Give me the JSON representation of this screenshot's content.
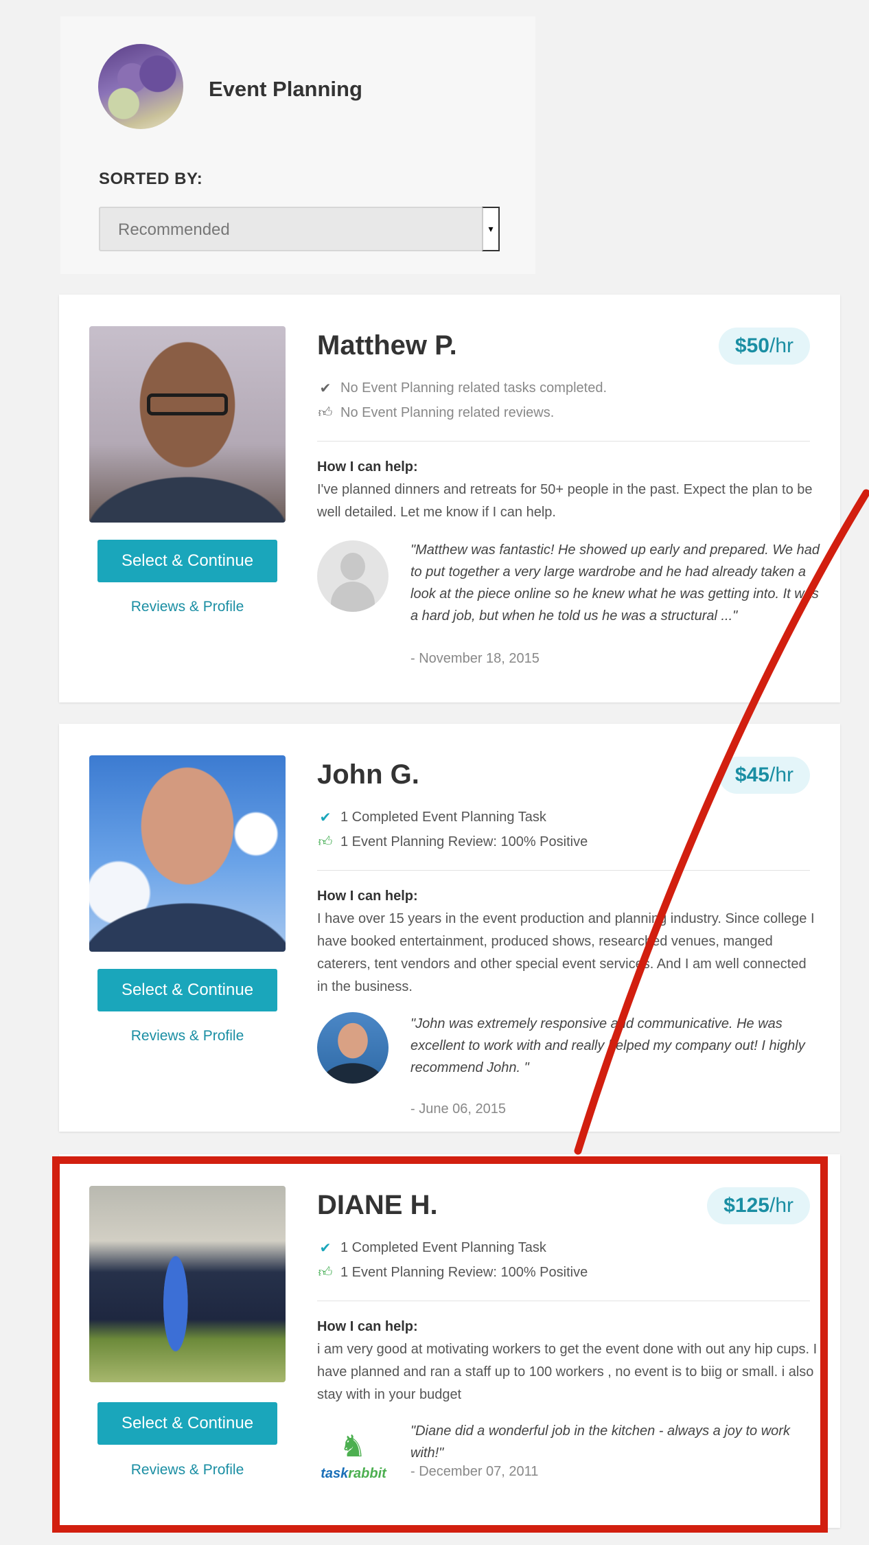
{
  "header": {
    "category_title": "Event Planning",
    "sorted_label": "SORTED BY:",
    "sort_value": "Recommended"
  },
  "taskers": [
    {
      "name": "Matthew P.",
      "price_amount": "$50",
      "price_unit": "/hr",
      "stat_tasks": "No Event Planning related tasks completed.",
      "stat_reviews": "No Event Planning related reviews.",
      "help_label": "How I can help:",
      "help_text": "I've planned dinners and retreats for 50+ people in the past. Expect the plan to be well detailed. Let me know if I can help.",
      "review_quote": "\"Matthew was fantastic!  He showed up early and prepared.  We had to put together a very large wardrobe and he had already taken a look at the piece online so he knew what he was getting into.  It was a hard job, but when he told us he was a structural ...\"",
      "review_date": "- November 18, 2015",
      "select_label": "Select & Continue",
      "profile_label": "Reviews & Profile"
    },
    {
      "name": "John G.",
      "price_amount": "$45",
      "price_unit": "/hr",
      "stat_tasks": "1 Completed Event Planning Task",
      "stat_reviews": "1 Event Planning Review: 100% Positive",
      "help_label": "How I can help:",
      "help_text": "I have over 15 years in the event production and planning industry. Since college I have booked entertainment, produced shows, researched venues, manged caterers, tent vendors and other special event services. And I am well connected in the business.",
      "review_quote": "\"John was extremely responsive and communicative. He was excellent to work with and really helped my company out! I highly recommend John. \"",
      "review_date": "- June 06, 2015",
      "select_label": "Select & Continue",
      "profile_label": "Reviews & Profile"
    },
    {
      "name": "DIANE H.",
      "price_amount": "$125",
      "price_unit": "/hr",
      "stat_tasks": "1 Completed Event Planning Task",
      "stat_reviews": "1 Event Planning Review: 100% Positive",
      "help_label": "How I can help:",
      "help_text": "i am very good at motivating workers to get the event done with out any hip cups. I have planned and ran a staff up to 100 workers , no event is to biig or small. i also stay with in your budget",
      "review_quote": "\"Diane did a wonderful job in the kitchen - always a joy to work with!\"",
      "review_date": "- December 07, 2011",
      "select_label": "Select & Continue",
      "profile_label": "Reviews & Profile",
      "reviewer_logo_text_a": "task",
      "reviewer_logo_text_b": "rabbit"
    }
  ],
  "icons": {
    "check": "check-icon",
    "thumb": "thumbs-up-icon",
    "dropdown": "dropdown-arrow-icon"
  },
  "colors": {
    "accent": "#1aa6bb",
    "link": "#1a8ea3",
    "positive": "#3aa94a",
    "annotation": "#d21f0f",
    "price_bg": "#e4f5f9"
  }
}
